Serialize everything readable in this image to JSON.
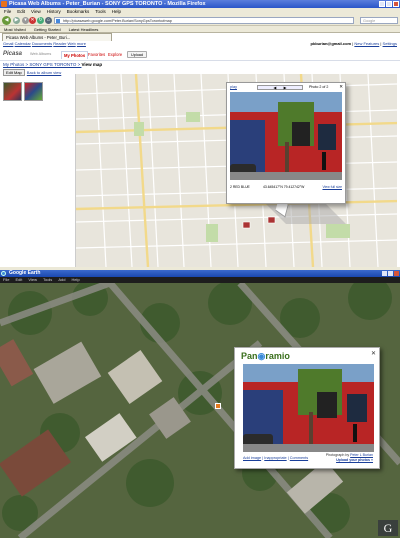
{
  "browser": {
    "window_title": "Picasa Web Albums - Peter_Burian - SONY GPS TORONTO - Mozilla Firefox",
    "menu": [
      "File",
      "Edit",
      "View",
      "History",
      "Bookmarks",
      "Tools",
      "Help"
    ],
    "url": "http://picasaweb.google.com/Peter.Burian/SonyGpsToronto#map",
    "search_placeholder": "Google",
    "bookmarks": [
      "Most Visited",
      "Getting Started",
      "Latest Headlines"
    ],
    "tab_title": "Picasa Web Albums - Peter_Buri..."
  },
  "google_bar": {
    "links": [
      "Gmail",
      "Calendar",
      "Documents",
      "Reader",
      "Web",
      "more"
    ],
    "account": "pkburian@gmail.com",
    "account_links": [
      "New Features",
      "Settings"
    ]
  },
  "picasa": {
    "logo": "Picasa",
    "logo_sub": "Web Albums",
    "tabs": [
      "My Photos",
      "Favorites",
      "Explore"
    ],
    "upload_label": "Upload",
    "breadcrumb_prefix": "My Photos > SONY GPS TORONTO > ",
    "breadcrumb_current": "View map",
    "edit_map_label": "Edit Map",
    "back_link": "Back to album view"
  },
  "map_popup": {
    "header_left": "play",
    "photo_counter": "Photo 2 of 2",
    "caption_left": "2 RED BLUE",
    "coords": "43.645417°N 79.412742°W",
    "view_full": "View full size"
  },
  "earth": {
    "window_title": "Google Earth",
    "menu": [
      "File",
      "Edit",
      "View",
      "Tools",
      "Add",
      "Help"
    ],
    "popup_logo_left": "Pan",
    "popup_logo_right": "ramio",
    "close_label": "✕",
    "links": [
      "Add image",
      "Inappropriate",
      "Comments"
    ],
    "credit_prefix": "Photograph by",
    "credit_author": "Peter L Burian",
    "credit_more": "Upload your photos »",
    "corner_logo": "G"
  }
}
